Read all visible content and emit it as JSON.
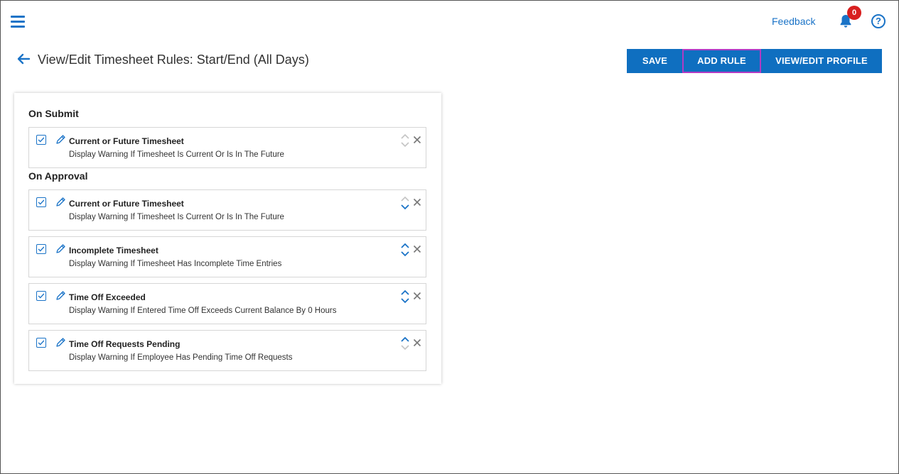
{
  "header": {
    "feedback_label": "Feedback",
    "notification_count": "0",
    "help_label": "?"
  },
  "page": {
    "title": "View/Edit Timesheet Rules: Start/End (All Days)"
  },
  "toolbar": {
    "save_label": "SAVE",
    "add_rule_label": "ADD RULE",
    "view_edit_profile_label": "VIEW/EDIT PROFILE"
  },
  "sections": {
    "on_submit": {
      "title": "On Submit",
      "rules": [
        {
          "title": "Current or Future Timesheet",
          "description": "Display Warning If Timesheet Is Current Or Is In The Future",
          "checked": true
        }
      ]
    },
    "on_approval": {
      "title": "On Approval",
      "rules": [
        {
          "title": "Current or Future Timesheet",
          "description": "Display Warning If Timesheet Is Current Or Is In The Future",
          "checked": true
        },
        {
          "title": "Incomplete Timesheet",
          "description": "Display Warning If Timesheet Has Incomplete Time Entries",
          "checked": true
        },
        {
          "title": "Time Off Exceeded",
          "description": "Display Warning If Entered Time Off Exceeds Current Balance By 0 Hours",
          "checked": true
        },
        {
          "title": "Time Off Requests Pending",
          "description": "Display Warning If Employee Has Pending Time Off Requests",
          "checked": true
        }
      ]
    }
  },
  "colors": {
    "accent": "#1a73c7",
    "button": "#0f6fc0",
    "badge": "#d81f1f",
    "highlight": "#b23bc4",
    "disabled_arrow": "#c4c4c4"
  }
}
